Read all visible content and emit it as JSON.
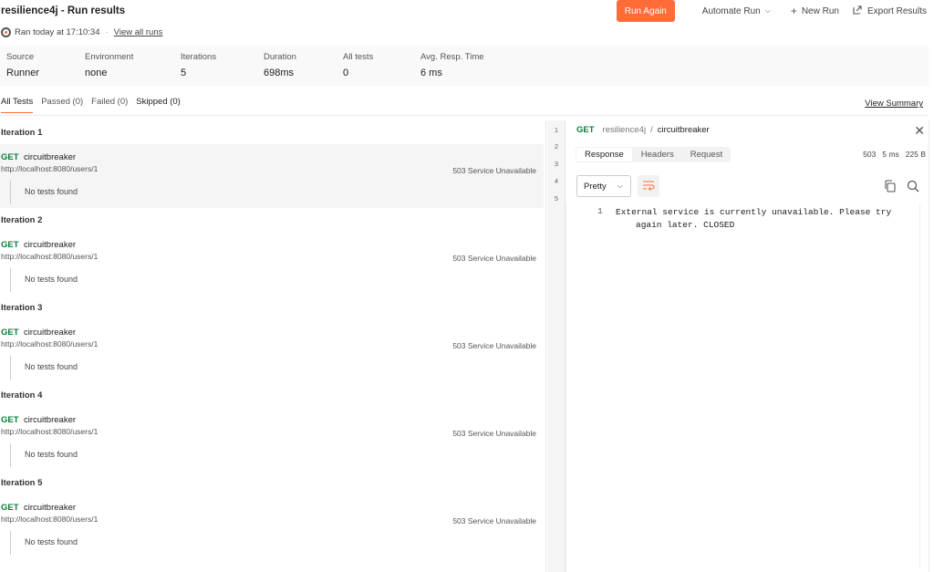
{
  "header": {
    "title": "resilience4j - Run results",
    "ran_text": "Ran today at 17:10:34",
    "separator": "·",
    "view_all_runs": "View all runs",
    "run_again": "Run Again",
    "automate_run": "Automate Run",
    "new_run": "New Run",
    "export_results": "Export Results",
    "accent_color": "#ff6c37"
  },
  "stats": [
    {
      "label": "Source",
      "value": "Runner"
    },
    {
      "label": "Environment",
      "value": "none"
    },
    {
      "label": "Iterations",
      "value": "5"
    },
    {
      "label": "Duration",
      "value": "698ms"
    },
    {
      "label": "All tests",
      "value": "0"
    },
    {
      "label": "Avg. Resp. Time",
      "value": "6 ms"
    }
  ],
  "filters": {
    "all": "All Tests",
    "passed": "Passed (0)",
    "failed": "Failed (0)",
    "skipped": "Skipped (0)",
    "view_summary": "View Summary"
  },
  "iterations": [
    {
      "title": "Iteration 1",
      "method": "GET",
      "name": "circuitbreaker",
      "url": "http://localhost:8080/users/1",
      "status": "503 Service Unavailable",
      "tests": "No tests found"
    },
    {
      "title": "Iteration 2",
      "method": "GET",
      "name": "circuitbreaker",
      "url": "http://localhost:8080/users/1",
      "status": "503 Service Unavailable",
      "tests": "No tests found"
    },
    {
      "title": "Iteration 3",
      "method": "GET",
      "name": "circuitbreaker",
      "url": "http://localhost:8080/users/1",
      "status": "503 Service Unavailable",
      "tests": "No tests found"
    },
    {
      "title": "Iteration 4",
      "method": "GET",
      "name": "circuitbreaker",
      "url": "http://localhost:8080/users/1",
      "status": "503 Service Unavailable",
      "tests": "No tests found"
    },
    {
      "title": "Iteration 5",
      "method": "GET",
      "name": "circuitbreaker",
      "url": "http://localhost:8080/users/1",
      "status": "503 Service Unavailable",
      "tests": "No tests found"
    }
  ],
  "gutter_numbers": [
    "1",
    "2",
    "3",
    "4",
    "5"
  ],
  "response_panel": {
    "method": "GET",
    "collection": "resilience4j",
    "separator": "/",
    "request": "circuitbreaker",
    "tabs": [
      "Response",
      "Headers",
      "Request"
    ],
    "status_code": "503",
    "time": "5 ms",
    "size": "225 B",
    "format": "Pretty",
    "line_number": "1",
    "body": "External service is currently unavailable. Please try again later. CLOSED"
  }
}
